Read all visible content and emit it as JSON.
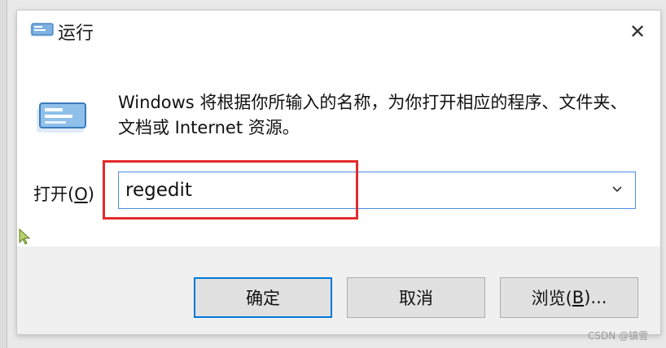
{
  "window": {
    "title": "运行",
    "close_glyph": "✕"
  },
  "content": {
    "description": "Windows 将根据你所输入的名称，为你打开相应的程序、文件夹、文档或 Internet 资源。",
    "open_label_prefix": "打开(",
    "open_label_access": "O",
    "open_label_suffix": ")",
    "input_value": "regedit"
  },
  "buttons": {
    "ok": "确定",
    "cancel": "取消",
    "browse_prefix": "浏览(",
    "browse_access": "B",
    "browse_suffix": ")..."
  },
  "annotation": {
    "highlight_color": "#e32b2b"
  },
  "watermark": "CSDN @镇雪",
  "icons": {
    "title_icon": "run-app-icon",
    "big_icon": "run-app-icon",
    "close_icon": "close-icon",
    "dropdown_icon": "chevron-down-icon",
    "cursor_icon": "pointer-cursor-icon"
  },
  "colors": {
    "accent": "#0078d7",
    "dialog_bg": "#ffffff",
    "footer_bg": "#f0f0f0"
  }
}
